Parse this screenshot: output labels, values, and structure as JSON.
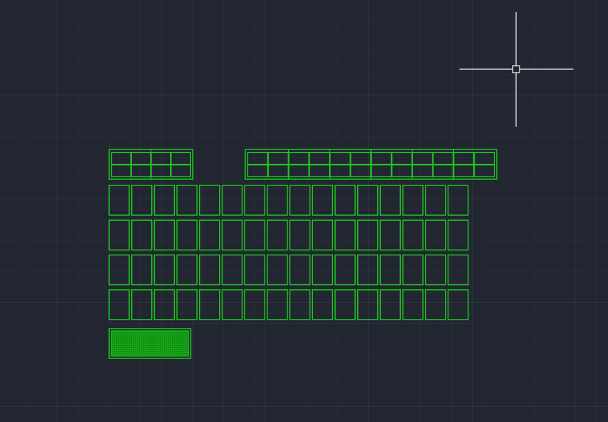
{
  "app": {
    "view": "cad-model-space",
    "colors": {
      "background": "#212630",
      "grid_minor": "#2a303b",
      "grid_major": "#323947",
      "entity": "#1ec81e",
      "crosshair": "#ffffff"
    }
  },
  "drawing": {
    "cell_groups": [
      {
        "name": "small-panel-group",
        "columns": 4,
        "cells_per_column": 2
      },
      {
        "name": "large-panel-group",
        "columns": 12,
        "cells_per_column": 2
      }
    ],
    "grid_blocks": {
      "rows": 4,
      "columns": 16
    },
    "hatch_block": {
      "pattern": "dots"
    }
  },
  "cursor": {
    "type": "crosshair",
    "icon": "crosshair-pickbox-icon"
  }
}
